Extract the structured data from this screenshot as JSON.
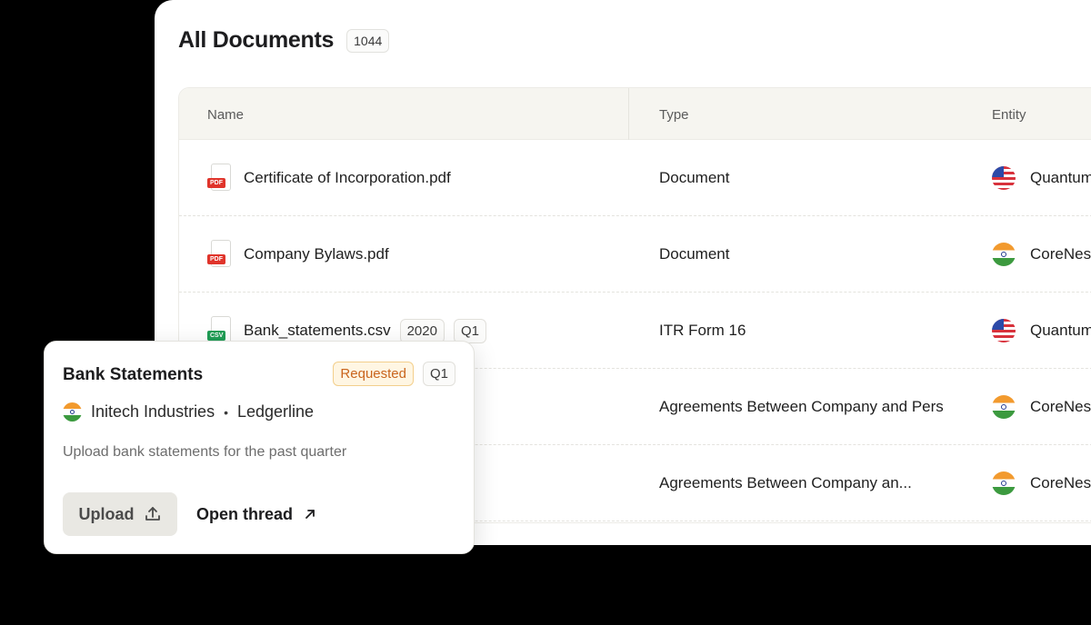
{
  "header": {
    "title": "All Documents",
    "count": "1044"
  },
  "table": {
    "columns": {
      "name": "Name",
      "type": "Type",
      "entity": "Entity"
    },
    "rows": [
      {
        "name": "Certificate of Incorporation.pdf",
        "file_kind": "PDF",
        "type": "Document",
        "entity": "Quantum",
        "flag": "us-flag-icon"
      },
      {
        "name": "Company Bylaws.pdf",
        "file_kind": "PDF",
        "type": "Document",
        "entity": "CoreNes",
        "flag": "india-flag-icon"
      },
      {
        "name": "Bank_statements.csv",
        "file_kind": "CSV",
        "tags": [
          "2020",
          "Q1"
        ],
        "type": "ITR Form 16",
        "entity": "Quantum",
        "flag": "us-flag-icon"
      },
      {
        "type": "Agreements Between Company and Pers",
        "entity": "CoreNes",
        "flag": "india-flag-icon"
      },
      {
        "type": "Agreements Between Company an...",
        "entity": "CoreNes",
        "flag": "india-flag-icon"
      }
    ]
  },
  "card": {
    "title": "Bank Statements",
    "status": "Requested",
    "period": "Q1",
    "entity": "Initech Industries",
    "separator": "•",
    "provider": "Ledgerline",
    "description": "Upload bank statements for the past quarter",
    "upload_label": "Upload",
    "open_label": "Open thread"
  },
  "colors": {
    "accent_requested": "#c9651d",
    "pdf_tag": "#e0342b",
    "csv_tag": "#1f9d55",
    "header_bg": "#f6f5f0"
  }
}
